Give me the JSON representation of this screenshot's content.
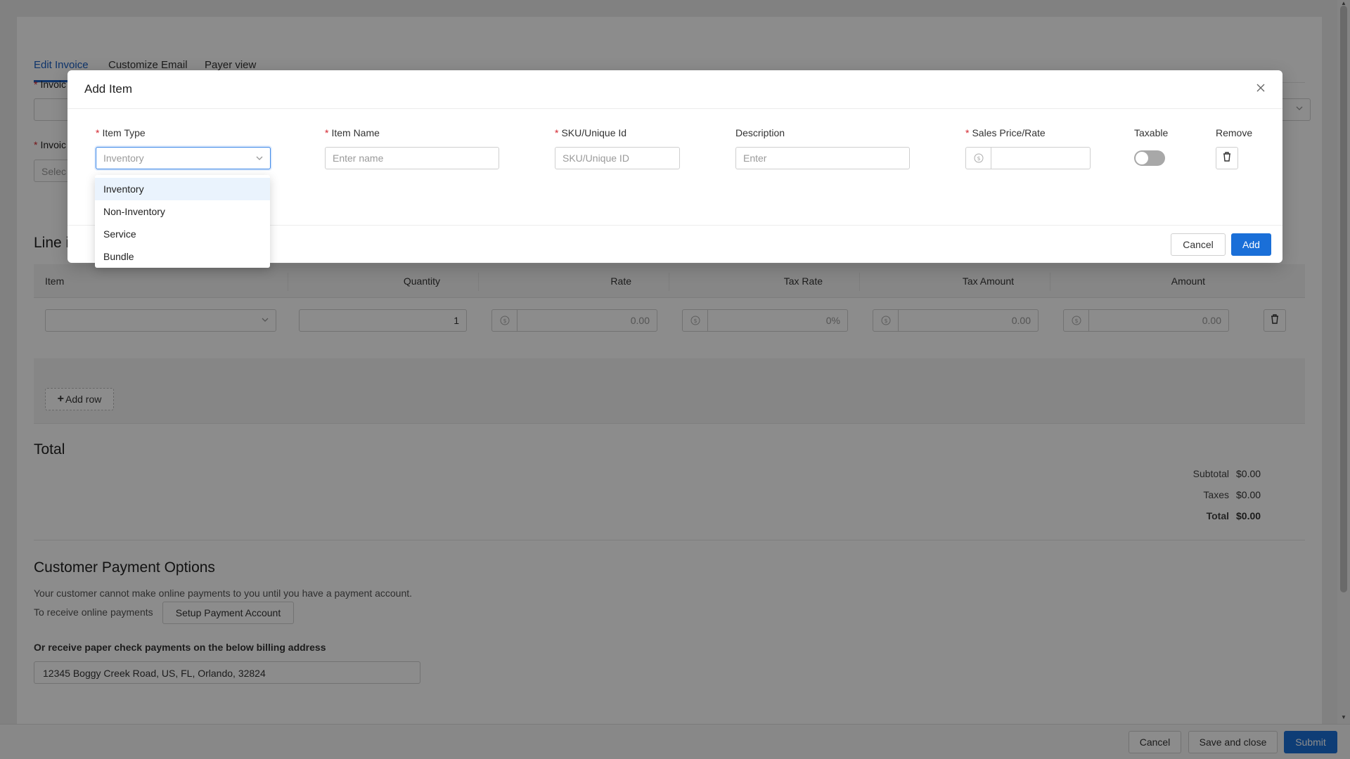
{
  "tabs": [
    {
      "label": "Edit Invoice",
      "active": true
    },
    {
      "label": "Customize Email",
      "active": false
    },
    {
      "label": "Payer view",
      "active": false
    }
  ],
  "background_form": {
    "field1_label_partial": "Invoic",
    "field2_label_partial": "Invoic",
    "field2_placeholder_partial": "Selec"
  },
  "line_items": {
    "title_partial": "Line i",
    "columns": [
      "Item",
      "Quantity",
      "Rate",
      "Tax Rate",
      "Tax Amount",
      "Amount"
    ],
    "row": {
      "quantity": "1",
      "rate": "0.00",
      "tax_rate": "0%",
      "tax_amount": "0.00",
      "amount": "0.00"
    },
    "add_row_label": "Add row"
  },
  "total": {
    "title": "Total",
    "rows": [
      {
        "label": "Subtotal",
        "value": "$0.00"
      },
      {
        "label": "Taxes",
        "value": "$0.00"
      },
      {
        "label": "Total",
        "value": "$0.00"
      }
    ]
  },
  "payment": {
    "title": "Customer Payment Options",
    "note": "Your customer cannot make online payments to you until you have a payment account.",
    "receive_label": "To receive online payments",
    "setup_button": "Setup Payment Account",
    "check_label": "Or receive paper check payments on the below billing address",
    "address": "12345 Boggy Creek Road, US, FL, Orlando, 32824"
  },
  "footer": {
    "cancel": "Cancel",
    "save_close": "Save and close",
    "submit": "Submit"
  },
  "modal": {
    "title": "Add Item",
    "fields": {
      "item_type": {
        "label": "Item Type",
        "value": "Inventory"
      },
      "item_name": {
        "label": "Item Name",
        "placeholder": "Enter name"
      },
      "sku": {
        "label": "SKU/Unique Id",
        "placeholder": "SKU/Unique ID"
      },
      "description": {
        "label": "Description",
        "placeholder": "Enter"
      },
      "sales_price": {
        "label": "Sales Price/Rate"
      },
      "taxable": {
        "label": "Taxable",
        "on": false
      },
      "remove": {
        "label": "Remove"
      }
    },
    "cancel": "Cancel",
    "add": "Add",
    "dropdown_options": [
      {
        "label": "Inventory",
        "active": true
      },
      {
        "label": "Non-Inventory",
        "active": false
      },
      {
        "label": "Service",
        "active": false
      },
      {
        "label": "Bundle",
        "active": false
      }
    ]
  },
  "colors": {
    "primary": "#1a6fd8",
    "required": "#d3262f",
    "tab_active": "#1a5fc4"
  },
  "icons": [
    "close-icon",
    "chevron-down-icon",
    "dollar-icon",
    "trash-icon",
    "plus-icon",
    "scroll-up-icon",
    "scroll-down-icon"
  ]
}
